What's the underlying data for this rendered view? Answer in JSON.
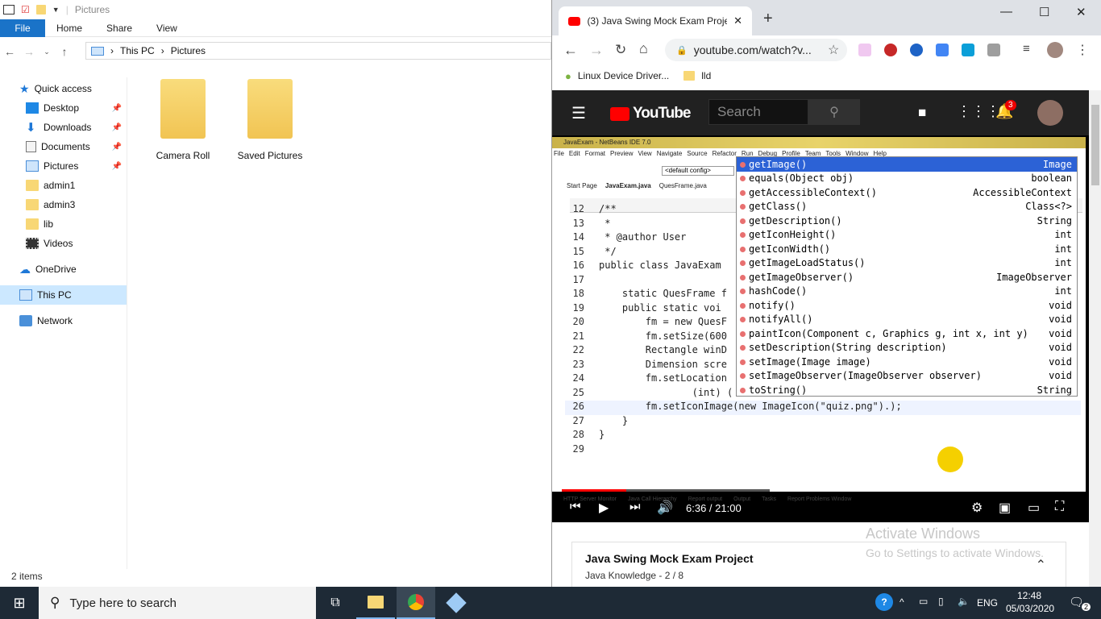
{
  "explorer": {
    "qat_title": "Pictures",
    "ribbon_tabs": [
      "File",
      "Home",
      "Share",
      "View"
    ],
    "breadcrumb": [
      "This PC",
      "Pictures"
    ],
    "nav": [
      {
        "label": "Quick access",
        "pinned": false
      },
      {
        "label": "Desktop",
        "pinned": true
      },
      {
        "label": "Downloads",
        "pinned": true
      },
      {
        "label": "Documents",
        "pinned": true
      },
      {
        "label": "Pictures",
        "pinned": true
      },
      {
        "label": "admin1",
        "pinned": false
      },
      {
        "label": "admin3",
        "pinned": false
      },
      {
        "label": "lib",
        "pinned": false
      },
      {
        "label": "Videos",
        "pinned": false
      },
      {
        "label": "OneDrive",
        "pinned": false
      },
      {
        "label": "This PC",
        "pinned": false
      },
      {
        "label": "Network",
        "pinned": false
      }
    ],
    "files": [
      "Camera Roll",
      "Saved Pictures"
    ],
    "status": "2 items"
  },
  "chrome": {
    "tab_title": "(3) Java Swing Mock Exam Projec",
    "url": "youtube.com/watch?v...",
    "bookmarks": [
      "Linux Device Driver...",
      "lld"
    ]
  },
  "youtube": {
    "logo": "YouTube",
    "search_placeholder": "Search",
    "notifications": "3",
    "video_time": "6:36 / 21:00",
    "playlist_title": "Java Swing Mock Exam Project",
    "playlist_channel": "Java Knowledge",
    "playlist_pos": "- 2 / 8",
    "progress": 0.31
  },
  "netbeans": {
    "title": "JavaExam - NetBeans IDE 7.0",
    "menu": [
      "File",
      "Edit",
      "Format",
      "Preview",
      "View",
      "Navigate",
      "Source",
      "Refactor",
      "Run",
      "Debug",
      "Profile",
      "Team",
      "Tools",
      "Window",
      "Help"
    ],
    "config": "<default config>",
    "tabs": [
      "Start Page",
      "JavaExam.java",
      "QuesFrame.java"
    ],
    "lines": [
      {
        "n": "12",
        "t": "/**"
      },
      {
        "n": "13",
        "t": " *"
      },
      {
        "n": "14",
        "t": " * @author User"
      },
      {
        "n": "15",
        "t": " */"
      },
      {
        "n": "16",
        "t": "public class JavaExam"
      },
      {
        "n": "17",
        "t": ""
      },
      {
        "n": "18",
        "t": "    static QuesFrame f"
      },
      {
        "n": "19",
        "t": "    public static voi"
      },
      {
        "n": "20",
        "t": "        fm = new QuesF"
      },
      {
        "n": "21",
        "t": "        fm.setSize(600"
      },
      {
        "n": "22",
        "t": "        Rectangle winD"
      },
      {
        "n": "23",
        "t": "        Dimension scre"
      },
      {
        "n": "24",
        "t": "        fm.setLocation"
      },
      {
        "n": "25",
        "t": "                (int) ("
      },
      {
        "n": "26",
        "t": "        fm.setIconImage(new ImageIcon(\"quiz.png\").);"
      },
      {
        "n": "27",
        "t": "    }"
      },
      {
        "n": "28",
        "t": "}"
      },
      {
        "n": "29",
        "t": ""
      }
    ],
    "autocomplete": [
      {
        "m": "getImage()",
        "r": "Image"
      },
      {
        "m": "equals(Object obj)",
        "r": "boolean"
      },
      {
        "m": "getAccessibleContext()",
        "r": "AccessibleContext"
      },
      {
        "m": "getClass()",
        "r": "Class<?>"
      },
      {
        "m": "getDescription()",
        "r": "String"
      },
      {
        "m": "getIconHeight()",
        "r": "int"
      },
      {
        "m": "getIconWidth()",
        "r": "int"
      },
      {
        "m": "getImageLoadStatus()",
        "r": "int"
      },
      {
        "m": "getImageObserver()",
        "r": "ImageObserver"
      },
      {
        "m": "hashCode()",
        "r": "int"
      },
      {
        "m": "notify()",
        "r": "void"
      },
      {
        "m": "notifyAll()",
        "r": "void"
      },
      {
        "m": "paintIcon(Component c, Graphics g, int x, int y)",
        "r": "void"
      },
      {
        "m": "setDescription(String description)",
        "r": "void"
      },
      {
        "m": "setImage(Image image)",
        "r": "void"
      },
      {
        "m": "setImageObserver(ImageObserver observer)",
        "r": "void"
      },
      {
        "m": "toString()",
        "r": "String"
      }
    ],
    "bottom_tabs": [
      "HTTP Server Monitor",
      "Java Call Hierarchy",
      "Report output",
      "Output",
      "Tasks",
      "Report Problems Window"
    ]
  },
  "watermark": {
    "title": "Activate Windows",
    "sub": "Go to Settings to activate Windows."
  },
  "taskbar": {
    "search_placeholder": "Type here to search",
    "lang": "ENG",
    "time": "12:48",
    "date": "05/03/2020",
    "notif_count": "2"
  }
}
